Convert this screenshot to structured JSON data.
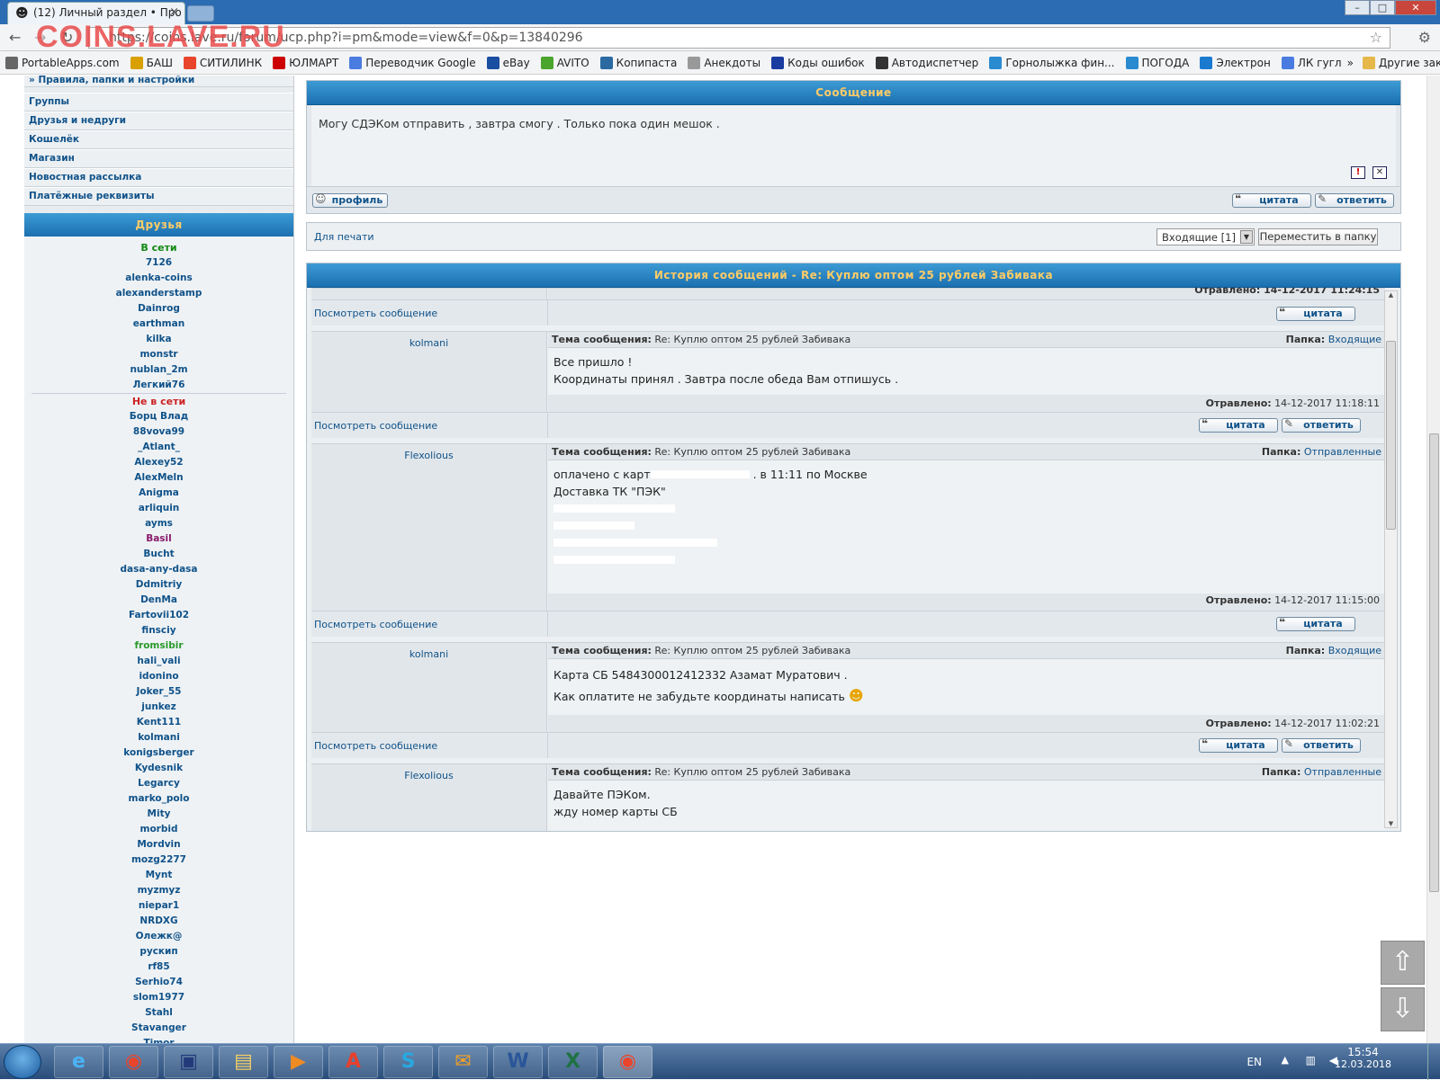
{
  "browser": {
    "tab_title": "(12) Личный раздел • Про",
    "url": "https://coins.lave.ru/forum/ucp.php?i=pm&mode=view&f=0&p=13840296",
    "watermark": "COINS.LAVE.RU",
    "bookmarks": [
      {
        "label": "PortableApps.com",
        "color": "#666"
      },
      {
        "label": "БАШ",
        "color": "#d8a000"
      },
      {
        "label": "СИТИЛИНК",
        "color": "#e8452c"
      },
      {
        "label": "ЮЛМАРТ",
        "color": "#c00"
      },
      {
        "label": "Переводчик Google",
        "color": "#4a7be0"
      },
      {
        "label": "eBay",
        "color": "#1a4ea0"
      },
      {
        "label": "AVITO",
        "color": "#4aa52c"
      },
      {
        "label": "Копипаста",
        "color": "#2a6aa0"
      },
      {
        "label": "Анекдоты",
        "color": "#999"
      },
      {
        "label": "Коды ошибок",
        "color": "#1a3ca0"
      },
      {
        "label": "Автодиспетчер",
        "color": "#333"
      },
      {
        "label": "Горнолыжка фин...",
        "color": "#2a8ad0"
      },
      {
        "label": "ПОГОДА",
        "color": "#2a8ad0"
      },
      {
        "label": "Электрон",
        "color": "#1a7ad0"
      },
      {
        "label": "ЛК гугл",
        "color": "#4a7be0"
      }
    ],
    "bookmarks_more": "»",
    "other_bookmarks": "Другие закладки"
  },
  "sidebar": {
    "top_item": "» Правила, папки и настройки",
    "menu": [
      "Группы",
      "Друзья и недруги",
      "Кошелёк",
      "Магазин",
      "Новостная рассылка",
      "Платёжные реквизиты"
    ],
    "friends_title": "Друзья",
    "online_title": "В сети",
    "online": [
      "7126",
      "alenka-coins",
      "alexanderstamp",
      "Dainrog",
      "earthman",
      "kilka",
      "monstr",
      "nublan_2m",
      "Легкий76"
    ],
    "offline_title": "Не в сети",
    "offline": [
      "Борц Влад",
      "88vova99",
      "_Atlant_",
      "Alexey52",
      "AlexMeln",
      "Anigma",
      "arliquin",
      "ayms",
      "Basil",
      "Bucht",
      "dasa-any-dasa",
      "Ddmitriy",
      "DenMa",
      "Fartovii102",
      "finsciy",
      "fromsibir",
      "hali_vali",
      "idonino",
      "Joker_55",
      "junkez",
      "Kent111",
      "kolmani",
      "konigsberger",
      "Kydesnik",
      "Legarcy",
      "marko_polo",
      "Mity",
      "morbid",
      "Mordvin",
      "mozg2277",
      "Mynt",
      "myzmyz",
      "niepar1",
      "NRDXG",
      "Олежк@",
      "рускип",
      "rf85",
      "Serhio74",
      "slom1977",
      "Stahl",
      "Stavanger",
      "Timor"
    ]
  },
  "message": {
    "title": "Сообщение",
    "text": "Могу СДЭКом отправить , завтра смогу . Только пока один мешок .",
    "profile_btn": "профиль",
    "quote_btn": "цитата",
    "reply_btn": "ответить",
    "report_icon": "!",
    "delete_icon": "✕"
  },
  "print_row": {
    "print_link": "Для печати",
    "folder_select": "Входящие [1]",
    "move_btn": "Переместить в папку"
  },
  "history": {
    "title": "История сообщений - Re: Куплю оптом 25 рублей Забивака",
    "subject_label": "Тема сообщения:",
    "subject": "Re: Куплю оптом 25 рублей Забивака",
    "folder_label": "Папка:",
    "sent_label": "Отравлено:",
    "view_link": "Посмотреть сообщение",
    "quote_btn": "цитата",
    "reply_btn": "ответить",
    "partial_sent": "Отравлено: 14-12-2017 11:24:15",
    "entries": [
      {
        "author": "kolmani",
        "folder": "Входящие",
        "lines": [
          "Все пришло !",
          "Координаты принял . Завтра после обеда Вам отпишусь ."
        ],
        "sent": "14-12-2017 11:18:11"
      },
      {
        "author": "Flexolious",
        "folder": "Отправленные",
        "lines": [
          "оплачено с карт",
          ". в 11:11 по Москве",
          "Доставка ТК \"ПЭК\""
        ],
        "sent": "14-12-2017 11:15:00"
      },
      {
        "author": "kolmani",
        "folder": "Входящие",
        "lines": [
          "Карта СБ 5484300012412332 Азамат Муратович .",
          "Как оплатите не забудьте координаты написать"
        ],
        "sent": "14-12-2017 11:02:21"
      },
      {
        "author": "Flexolious",
        "folder": "Отправленные",
        "lines": [
          "Давайте ПЭКом.",
          "жду номер карты СБ"
        ],
        "sent": ""
      }
    ]
  },
  "page_arrows": {
    "up": "⇧",
    "down": "⇩"
  },
  "taskbar": {
    "lang": "EN",
    "time": "15:54",
    "date": "12.03.2018"
  }
}
